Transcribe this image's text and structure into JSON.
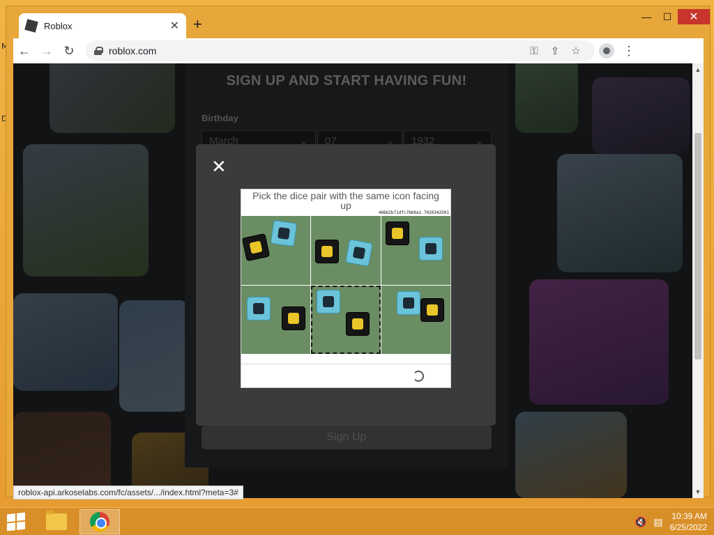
{
  "browser": {
    "tab_title": "Roblox",
    "tab_close": "✕",
    "new_tab": "+",
    "url": "roblox.com",
    "status_url": "roblox-api.arkoselabs.com/fc/assets/.../index.html?meta=3#"
  },
  "window_controls": {
    "minimize": "—",
    "maximize": "☐",
    "close": "✕"
  },
  "signup": {
    "heading": "SIGN UP AND START HAVING FUN!",
    "birthday_label": "Birthday",
    "month": "March",
    "day": "07",
    "year": "1932",
    "signup_button": "Sign Up"
  },
  "modal": {
    "close": "✕",
    "captcha": {
      "question": "Pick the dice pair with the same icon facing up",
      "session_id": "48662b71dfc7bb9a1.7020342501",
      "selected_index": 4
    }
  },
  "taskbar": {
    "time": "10:39 AM",
    "date": "6/25/2022"
  },
  "colors": {
    "modal_bg": "#393b3d",
    "page_bg": "#1d1e20",
    "accent": "#e8a73a"
  }
}
